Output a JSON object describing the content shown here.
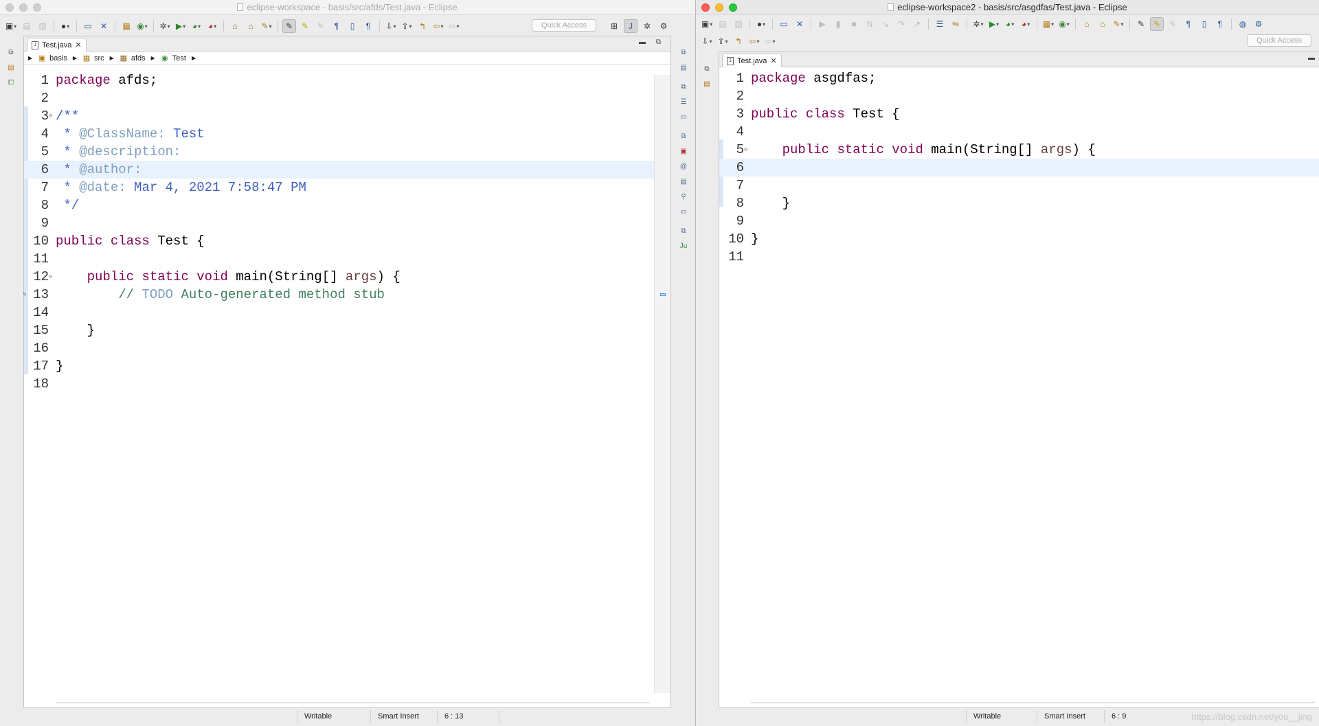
{
  "left": {
    "window_title": "eclipse-workspace - basis/src/afds/Test.java - Eclipse",
    "quick_access": "Quick Access",
    "tab_label": "Test.java",
    "breadcrumb": [
      {
        "label": "basis",
        "icon": "project-icon"
      },
      {
        "label": "src",
        "icon": "source-folder-icon"
      },
      {
        "label": "afds",
        "icon": "package-icon"
      },
      {
        "label": "Test",
        "icon": "class-icon"
      }
    ],
    "lines": [
      "1",
      "2",
      "3",
      "4",
      "5",
      "6",
      "7",
      "8",
      "9",
      "10",
      "11",
      "12",
      "13",
      "14",
      "15",
      "16",
      "17",
      "18"
    ],
    "code": {
      "l1_kw": "package",
      "l1_rest": " afds;",
      "l3": "/**",
      "l4_a": " * ",
      "l4_tag": "@ClassName:",
      "l4_val": " Test",
      "l5_a": " * ",
      "l5_tag": "@description:",
      "l6_a": " * ",
      "l6_tag": "@author:",
      "l7_a": " * ",
      "l7_tag": "@date:",
      "l7_val": " Mar 4, 2021 7:58:47 PM",
      "l8": " */",
      "l10_kw1": "public",
      "l10_kw2": "class",
      "l10_rest": " Test {",
      "l12_kw1": "public",
      "l12_kw2": "static",
      "l12_kw3": "void",
      "l12_mid": " main(String[] ",
      "l12_param": "args",
      "l12_end": ") {",
      "l13_a": "// ",
      "l13_todo": "TODO",
      "l13_rest": " Auto-generated method stub",
      "l15": "}",
      "l17": "}"
    },
    "status": {
      "writable": "Writable",
      "insert_mode": "Smart Insert",
      "position": "6 : 13"
    }
  },
  "right": {
    "window_title": "eclipse-workspace2 - basis/src/asgdfas/Test.java - Eclipse",
    "quick_access": "Quick Access",
    "tab_label": "Test.java",
    "lines": [
      "1",
      "2",
      "3",
      "4",
      "5",
      "6",
      "7",
      "8",
      "9",
      "10",
      "11"
    ],
    "code": {
      "l1_kw": "package",
      "l1_rest": " asgdfas;",
      "l3_kw1": "public",
      "l3_kw2": "class",
      "l3_rest": " Test {",
      "l5_kw1": "public",
      "l5_kw2": "static",
      "l5_kw3": "void",
      "l5_mid": " main(String[] ",
      "l5_param": "args",
      "l5_end": ") {",
      "l8": "}",
      "l10": "}"
    },
    "status": {
      "writable": "Writable",
      "insert_mode": "Smart Insert",
      "position": "6 : 9"
    },
    "watermark": "https://blog.csdn.net/you__jing"
  },
  "colors": {
    "keyword": "#7f0055",
    "javadoc": "#3f5fbf",
    "comment": "#3f7f5f",
    "current_line": "#e8f2fe"
  }
}
